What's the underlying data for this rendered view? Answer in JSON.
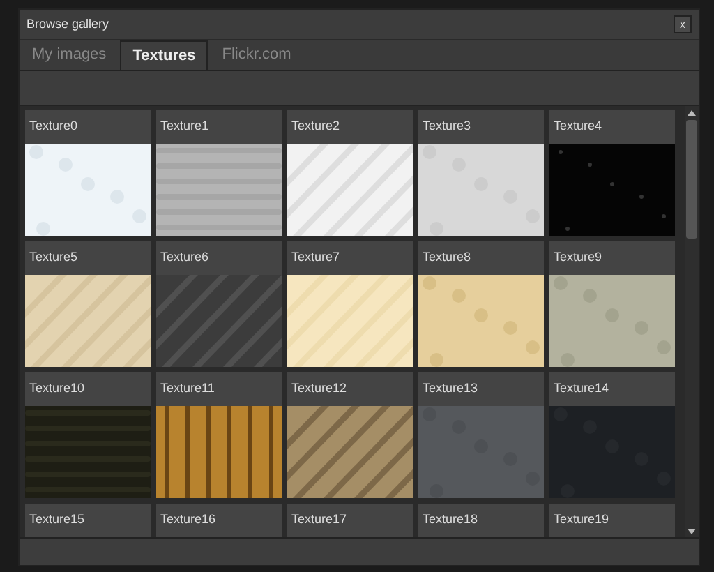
{
  "window": {
    "title": "Browse gallery",
    "close": "x"
  },
  "tabs": [
    {
      "label": "My images",
      "selected": false
    },
    {
      "label": "Textures",
      "selected": true
    },
    {
      "label": "Flickr.com",
      "selected": false
    }
  ],
  "gallery": [
    {
      "label": "Texture0",
      "kind": "picture"
    },
    {
      "label": "Texture1",
      "kind": "picture"
    },
    {
      "label": "Texture2",
      "kind": "picture"
    },
    {
      "label": "Texture3",
      "kind": "picture"
    },
    {
      "label": "Texture4",
      "kind": "picture"
    },
    {
      "label": "Texture5",
      "kind": "picture"
    },
    {
      "label": "Texture6",
      "kind": "picture"
    },
    {
      "label": "Texture7",
      "kind": "picture"
    },
    {
      "label": "Texture8",
      "kind": "picture"
    },
    {
      "label": "Texture9",
      "kind": "picture"
    },
    {
      "label": "Texture10",
      "kind": "picture"
    },
    {
      "label": "Texture11",
      "kind": "picture"
    },
    {
      "label": "Texture12",
      "kind": "picture"
    },
    {
      "label": "Texture13",
      "kind": "picture"
    },
    {
      "label": "Texture14",
      "kind": "picture"
    },
    {
      "label": "Texture15"
    },
    {
      "label": "Texture16"
    },
    {
      "label": "Texture17"
    },
    {
      "label": "Texture18"
    },
    {
      "label": "Texture19"
    }
  ]
}
